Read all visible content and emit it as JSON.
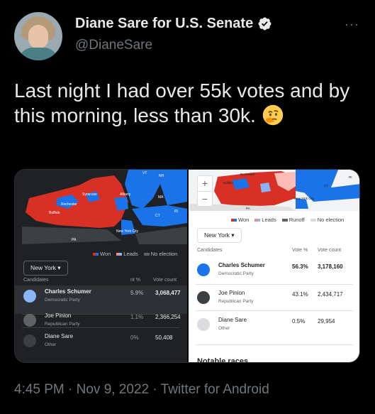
{
  "tweet": {
    "display_name": "Diane Sare for U.S. Senate",
    "handle": "@DianeSare",
    "text": "Last night I had over 55k votes and by this morning, less than 30k.",
    "timestamp": "4:45 PM · Nov 9, 2022 · Twitter for Android",
    "more_label": "···"
  },
  "left_panel": {
    "map_labels": [
      "VT",
      "NH",
      "Syracuse",
      "Albany",
      "MA",
      "Rochester",
      "Buffalo",
      "CT",
      "RI",
      "New York City",
      "PA"
    ],
    "legend": {
      "won": "Won",
      "leads": "Leads",
      "no_election": "No election"
    },
    "state_select": "New York",
    "headers": {
      "candidates": "Candidates",
      "pct": "nt %",
      "votes": "Vote count"
    },
    "rows": [
      {
        "name": "Charles Schumer",
        "party": "Democratic Party",
        "pct": "5.9%",
        "votes": "3,068,477"
      },
      {
        "name": "Joe Pinion",
        "party": "Republican Party",
        "pct": "1.1%",
        "votes": "2,366,254"
      },
      {
        "name": "Diane Sare",
        "party": "Other",
        "pct": "0%",
        "votes": "50,408"
      }
    ]
  },
  "right_panel": {
    "map_labels": [
      "Rochester",
      "Buffalo",
      "CT",
      "RI",
      "New York City",
      "PA"
    ],
    "zoom_in": "+",
    "zoom_out": "−",
    "legend": {
      "won": "Won",
      "leads": "Leads",
      "runoff": "Runoff",
      "no_election": "No election"
    },
    "state_select": "New York",
    "headers": {
      "candidates": "Candidates",
      "pct": "Vote %",
      "votes": "Vote count"
    },
    "rows": [
      {
        "name": "Charles Schumer",
        "party": "Democratic Party",
        "pct": "56.3%",
        "votes": "3,178,160"
      },
      {
        "name": "Joe Pinion",
        "party": "Republican Party",
        "pct": "43.1%",
        "votes": "2,434,717"
      },
      {
        "name": "Diane Sare",
        "party": "Other",
        "pct": "0.5%",
        "votes": "29,954"
      }
    ],
    "notable": "Notable races"
  },
  "colors": {
    "dem": "#1a73e8",
    "rep": "#d93025",
    "verified": "#e7e9ea",
    "background": "#000000",
    "muted": "#71767b"
  },
  "icons": {
    "verified": "verified-badge-icon",
    "emoji": "thinking-face-emoji",
    "dropdown": "caret-down-icon",
    "more": "more-horizontal-icon"
  }
}
